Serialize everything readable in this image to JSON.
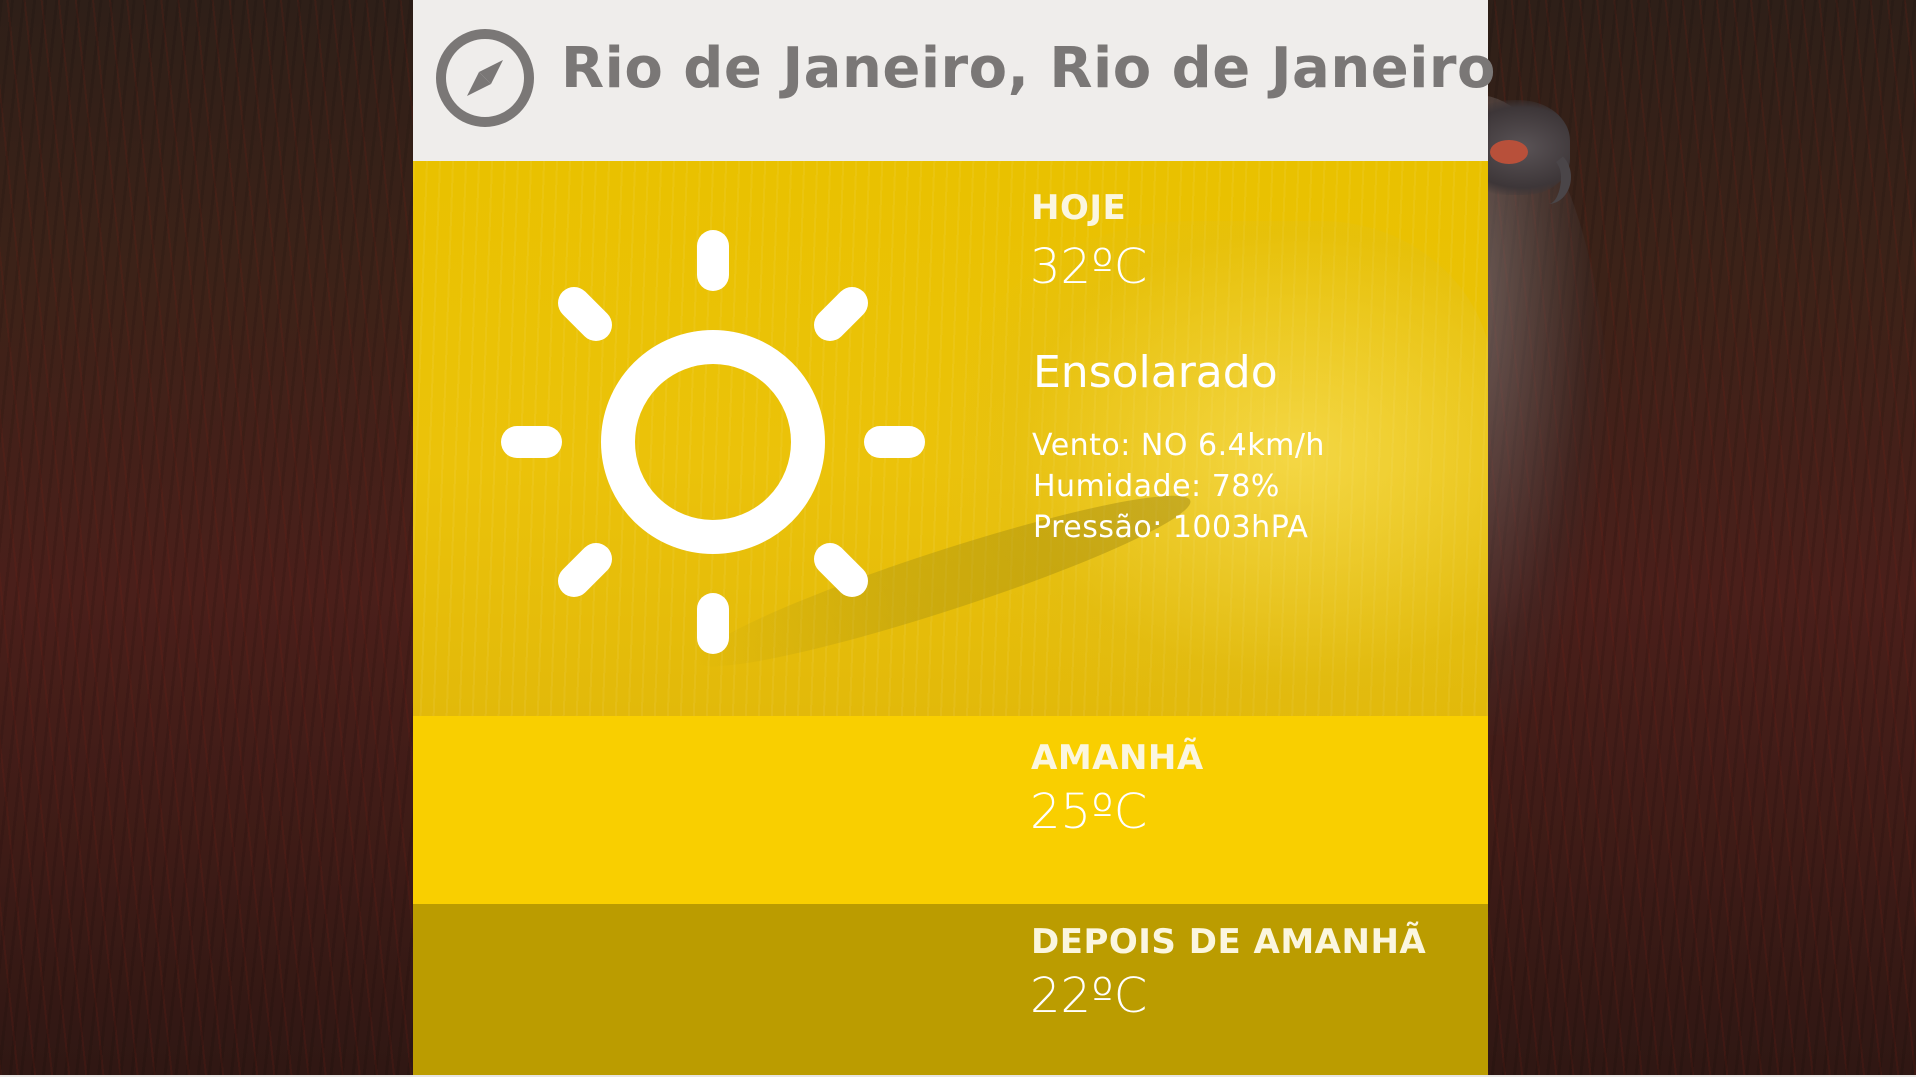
{
  "header": {
    "city": "Rio de Janeiro, Rio de Janeiro",
    "icon": "compass-icon"
  },
  "today": {
    "label": "HOJE",
    "temperature": "32ºC",
    "condition": "Ensolarado",
    "icon": "sun-icon",
    "wind": "Vento: NO 6.4km/h",
    "humidity": "Humidade: 78%",
    "pressure": "Pressão: 1003hPA"
  },
  "tomorrow": {
    "label": "AMANHÃ",
    "temperature": "25ºC"
  },
  "day_after": {
    "label": "DEPOIS DE AMANHÃ",
    "temperature": "22ºC"
  },
  "colors": {
    "header_bg": "#efedeb",
    "header_text": "#7a7776",
    "today_bg": "#ebc20a",
    "tomorrow_bg": "#f9cf00",
    "day_after_bg": "#bb9c00",
    "text_light": "#ffffff"
  }
}
